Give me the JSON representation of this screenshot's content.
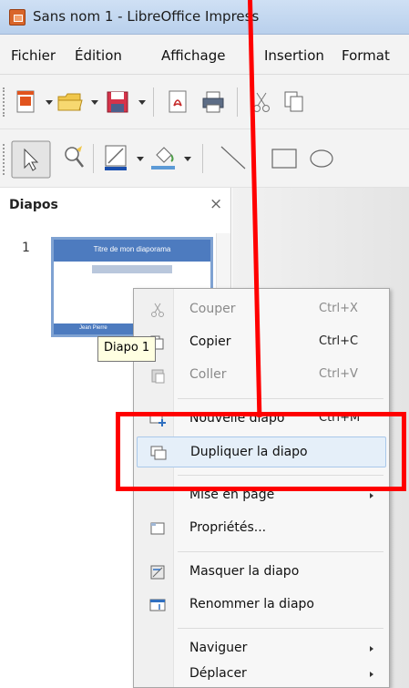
{
  "window": {
    "title": "Sans nom 1 - LibreOffice Impress"
  },
  "menubar": {
    "items": [
      {
        "label": "Fichier",
        "accel": "F"
      },
      {
        "label": "Édition",
        "accel": "d"
      },
      {
        "label": "Affichage",
        "accel": "A"
      },
      {
        "label": "Insertion",
        "accel": "I"
      },
      {
        "label": "Format",
        "accel": "t"
      }
    ]
  },
  "slide_pane": {
    "title": "Diapos",
    "close": "×",
    "slide_number": "1",
    "thumbnail": {
      "title": "Titre de mon diaporama",
      "author": "Jean Pierre"
    }
  },
  "tooltip": {
    "text": "Diapo 1"
  },
  "context_menu": {
    "items": [
      {
        "label": "Couper",
        "shortcut": "Ctrl+X",
        "icon": "scissors-icon",
        "disabled": true
      },
      {
        "label": "Copier",
        "shortcut": "Ctrl+C",
        "icon": "copy-icon",
        "disabled": false
      },
      {
        "label": "Coller",
        "shortcut": "Ctrl+V",
        "icon": "paste-icon",
        "disabled": true
      },
      {
        "label": "Nouvelle diapo",
        "shortcut": "Ctrl+M",
        "icon": "new-slide-icon",
        "disabled": false
      },
      {
        "label": "Dupliquer la diapo",
        "shortcut": "",
        "icon": "duplicate-slide-icon",
        "disabled": false,
        "highlighted": true
      },
      {
        "label": "Mise en page",
        "shortcut": "",
        "icon": "",
        "submenu": true
      },
      {
        "label": "Propriétés...",
        "shortcut": "",
        "icon": "properties-icon"
      },
      {
        "label": "Masquer la diapo",
        "shortcut": "",
        "icon": "hide-slide-icon"
      },
      {
        "label": "Renommer la diapo",
        "shortcut": "",
        "icon": "rename-slide-icon"
      },
      {
        "label": "Naviguer",
        "shortcut": "",
        "icon": "",
        "submenu": true
      },
      {
        "label": "Déplacer",
        "shortcut": "",
        "icon": "",
        "submenu": true
      }
    ]
  },
  "colors": {
    "annotation": "#ff0000",
    "highlight": "#e5eff9",
    "slide_header": "#4d7bbf"
  }
}
